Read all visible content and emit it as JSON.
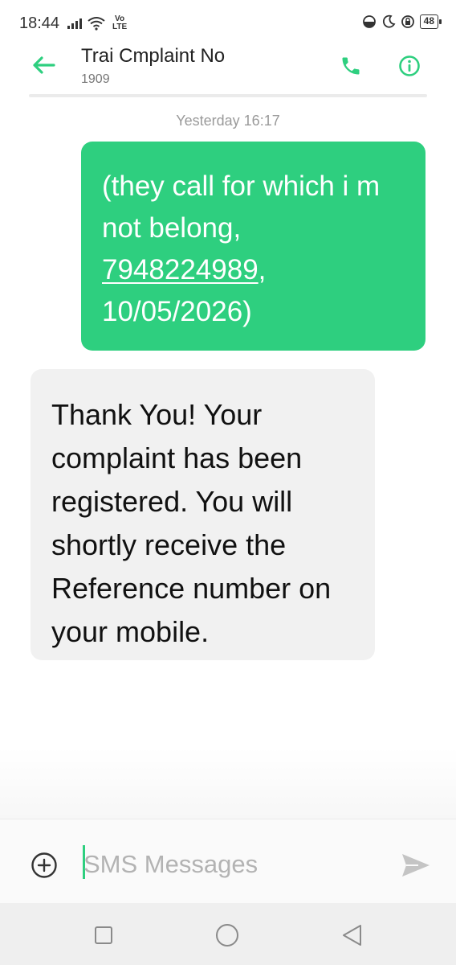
{
  "status_bar": {
    "time": "18:44",
    "network": "Vo LTE",
    "battery": "48"
  },
  "header": {
    "title": "Trai Cmplaint No",
    "subtitle": "1909",
    "back_icon": "arrow-left-icon",
    "call_icon": "phone-icon",
    "info_icon": "info-icon",
    "accent_color": "#2ecf7f"
  },
  "conversation": {
    "timestamp": "Yesterday 16:17",
    "sent_message": {
      "text_before": "(they call for which i m not belong, ",
      "phone_number": "7948224989",
      "text_after": ", 10/05/2026)",
      "bubble_color": "#2ecf7f"
    },
    "received_message": {
      "text": "Thank You! Your complaint has been registered. You will shortly receive the Reference number on your mobile.",
      "bubble_color": "#f1f1f1"
    }
  },
  "compose": {
    "placeholder": "SMS Messages",
    "add_icon": "add-circle-icon",
    "send_icon": "send-icon"
  },
  "nav_bar": {
    "recent_icon": "square-icon",
    "home_icon": "circle-icon",
    "back_icon": "triangle-back-icon"
  }
}
